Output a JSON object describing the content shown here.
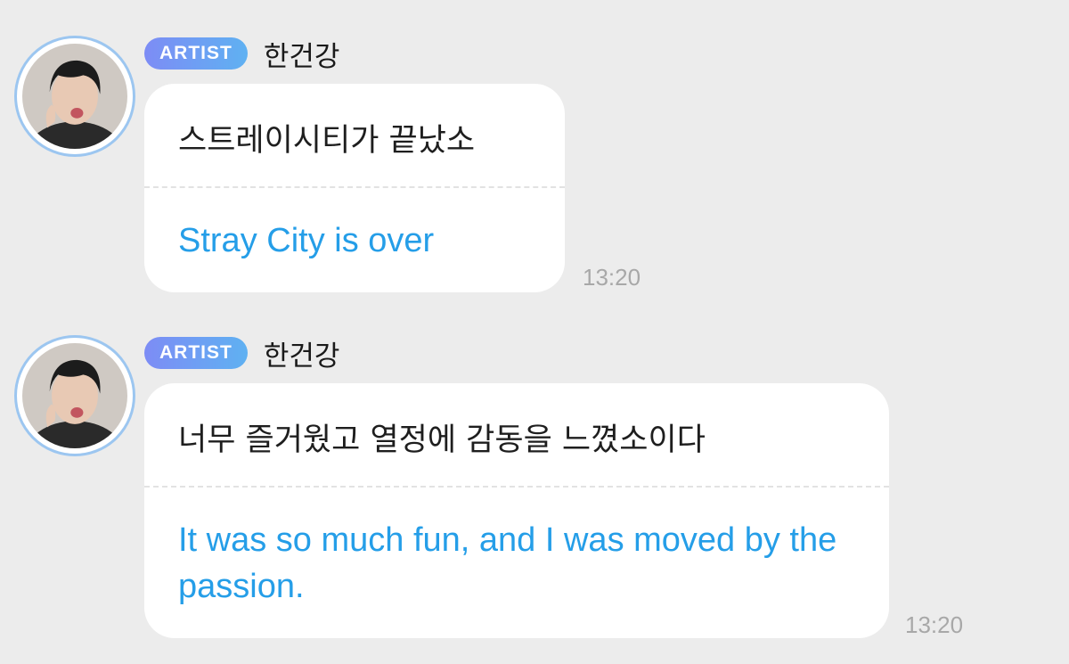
{
  "messages": [
    {
      "badge": "ARTIST",
      "sender": "한건강",
      "original": "스트레이시티가 끝났소",
      "translation": "Stray City is over",
      "time": "13:20"
    },
    {
      "badge": "ARTIST",
      "sender": "한건강",
      "original": "너무 즐거웠고 열정에 감동을 느꼈소이다",
      "translation": "It was so much fun, and I was moved by the passion.",
      "time": "13:20"
    }
  ],
  "colors": {
    "background": "#ececec",
    "bubble": "#ffffff",
    "translation_text": "#259ee8",
    "badge_gradient_start": "#7d8cf5",
    "badge_gradient_end": "#5fb1f2",
    "avatar_ring": "#9cc6f0",
    "timestamp": "#a8a8a8"
  },
  "icons": {
    "avatar": "artist-profile-photo"
  }
}
